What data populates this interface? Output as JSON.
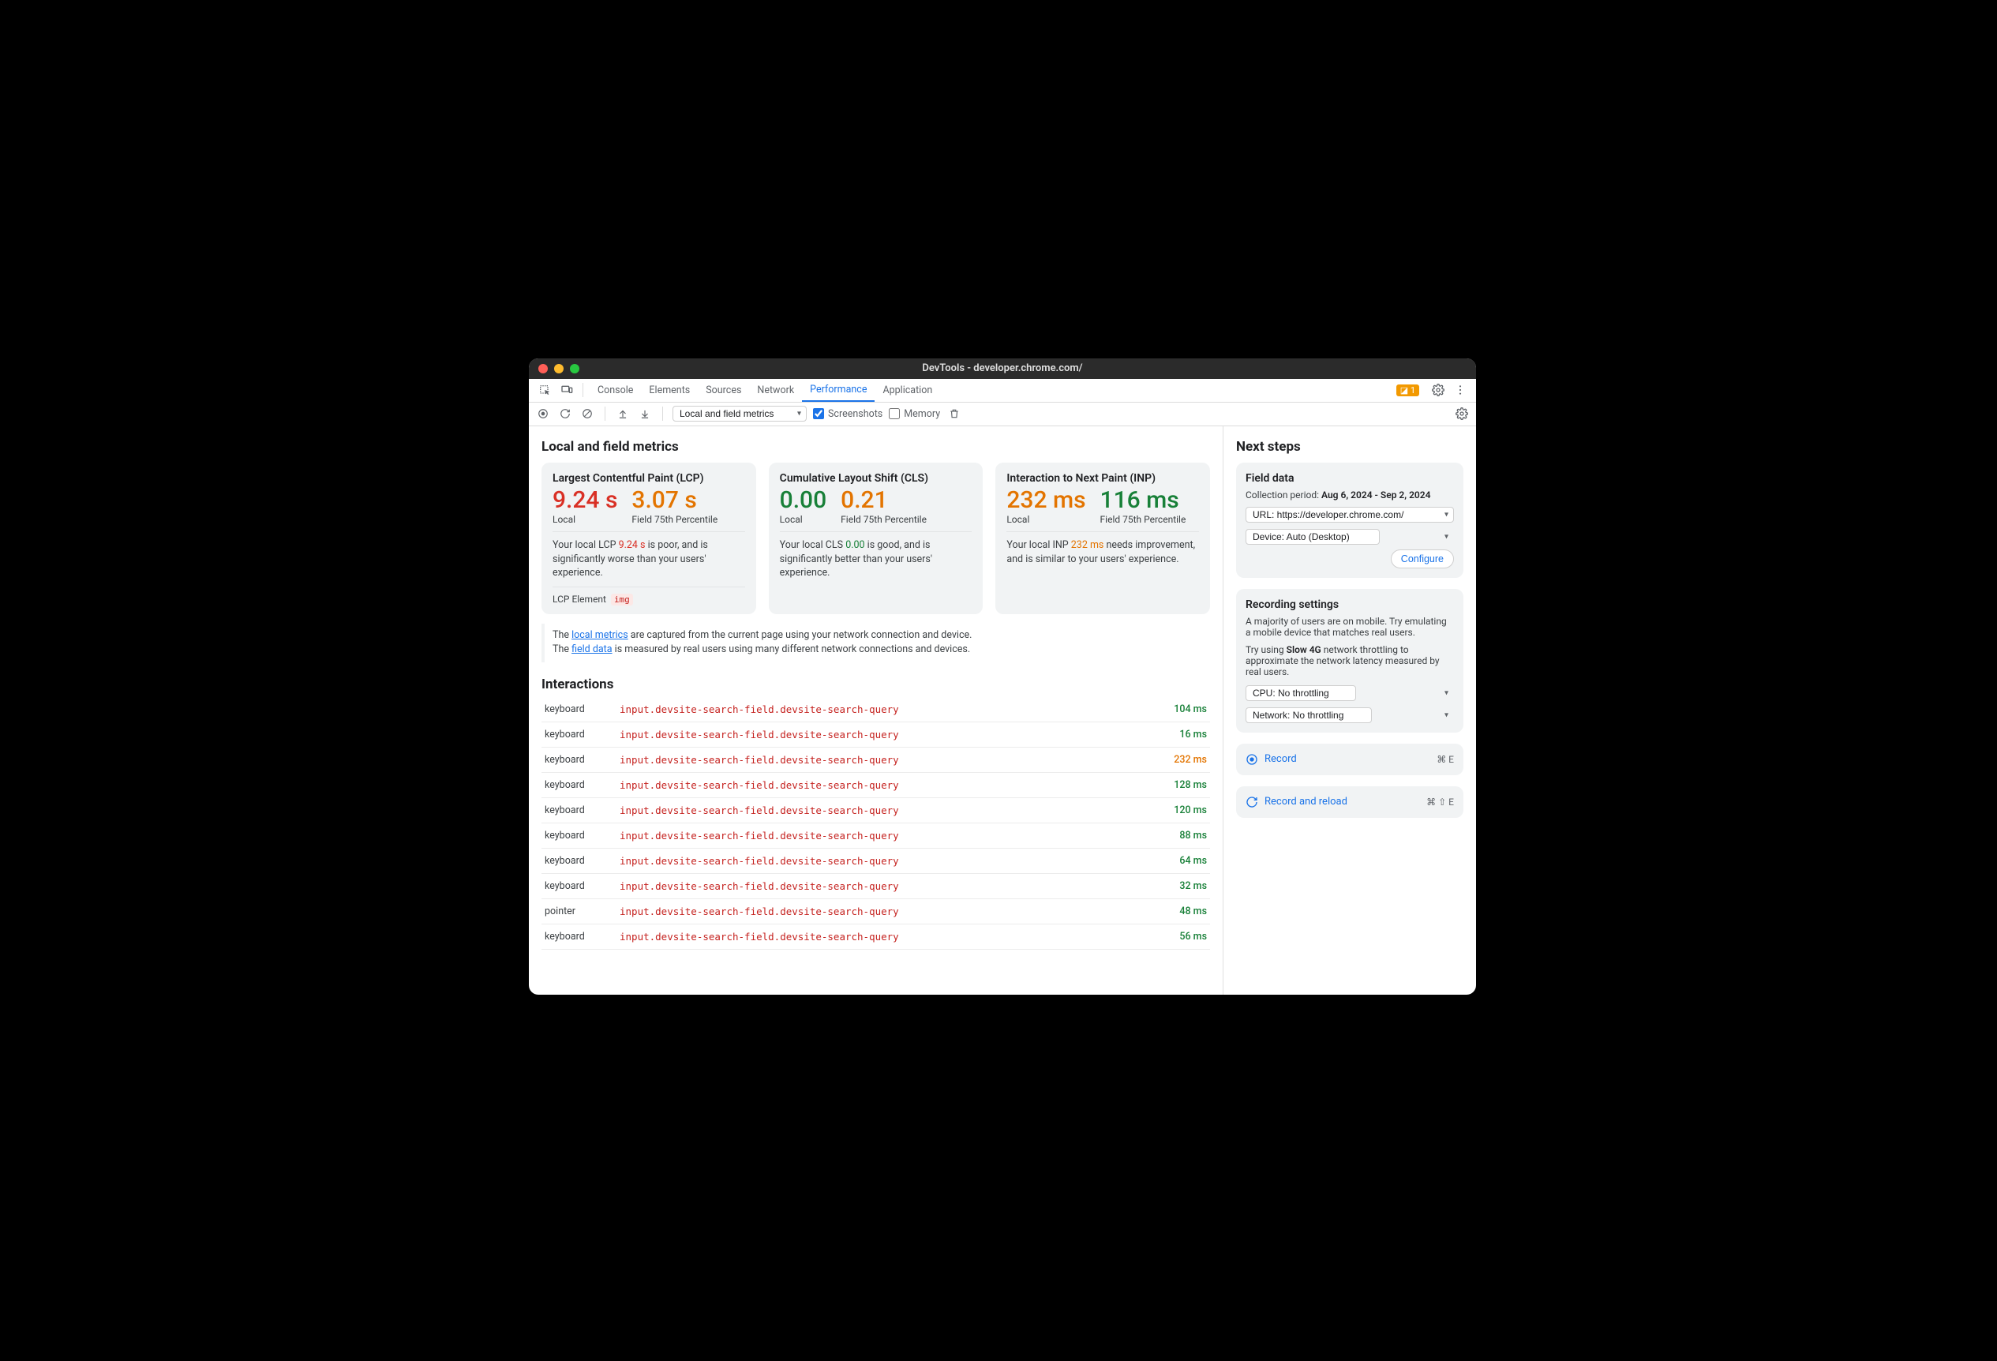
{
  "window": {
    "title": "DevTools - developer.chrome.com/"
  },
  "tabs": {
    "items": [
      "Console",
      "Elements",
      "Sources",
      "Network",
      "Performance",
      "Application"
    ],
    "active": "Performance",
    "warning_count": "1"
  },
  "toolbar": {
    "mode_select": "Local and field metrics",
    "screenshots_label": "Screenshots",
    "screenshots_checked": true,
    "memory_label": "Memory",
    "memory_checked": false
  },
  "main": {
    "heading": "Local and field metrics",
    "cards": {
      "lcp": {
        "title": "Largest Contentful Paint (LCP)",
        "local_value": "9.24 s",
        "local_label": "Local",
        "field_value": "3.07 s",
        "field_label": "Field 75th Percentile",
        "summary_pre": "Your local LCP ",
        "summary_val": "9.24 s",
        "summary_post": " is poor, and is significantly worse than your users' experience.",
        "extra_label": "LCP Element",
        "extra_chip": "img"
      },
      "cls": {
        "title": "Cumulative Layout Shift (CLS)",
        "local_value": "0.00",
        "local_label": "Local",
        "field_value": "0.21",
        "field_label": "Field 75th Percentile",
        "summary_pre": "Your local CLS ",
        "summary_val": "0.00",
        "summary_post": " is good, and is significantly better than your users' experience."
      },
      "inp": {
        "title": "Interaction to Next Paint (INP)",
        "local_value": "232 ms",
        "local_label": "Local",
        "field_value": "116 ms",
        "field_label": "Field 75th Percentile",
        "summary_pre": "Your local INP ",
        "summary_val": "232 ms",
        "summary_post": " needs improvement, and is similar to your users' experience."
      }
    },
    "infobox": {
      "line1_pre": "The ",
      "line1_link": "local metrics",
      "line1_post": " are captured from the current page using your network connection and device.",
      "line2_pre": "The ",
      "line2_link": "field data",
      "line2_post": " is measured by real users using many different network connections and devices."
    },
    "interactions_heading": "Interactions",
    "interactions": [
      {
        "type": "keyboard",
        "selector": "input.devsite-search-field.devsite-search-query",
        "time": "104 ms",
        "cls": "green"
      },
      {
        "type": "keyboard",
        "selector": "input.devsite-search-field.devsite-search-query",
        "time": "16 ms",
        "cls": "green"
      },
      {
        "type": "keyboard",
        "selector": "input.devsite-search-field.devsite-search-query",
        "time": "232 ms",
        "cls": "amber"
      },
      {
        "type": "keyboard",
        "selector": "input.devsite-search-field.devsite-search-query",
        "time": "128 ms",
        "cls": "green"
      },
      {
        "type": "keyboard",
        "selector": "input.devsite-search-field.devsite-search-query",
        "time": "120 ms",
        "cls": "green"
      },
      {
        "type": "keyboard",
        "selector": "input.devsite-search-field.devsite-search-query",
        "time": "88 ms",
        "cls": "green"
      },
      {
        "type": "keyboard",
        "selector": "input.devsite-search-field.devsite-search-query",
        "time": "64 ms",
        "cls": "green"
      },
      {
        "type": "keyboard",
        "selector": "input.devsite-search-field.devsite-search-query",
        "time": "32 ms",
        "cls": "green"
      },
      {
        "type": "pointer",
        "selector": "input.devsite-search-field.devsite-search-query",
        "time": "48 ms",
        "cls": "green"
      },
      {
        "type": "keyboard",
        "selector": "input.devsite-search-field.devsite-search-query",
        "time": "56 ms",
        "cls": "green"
      }
    ]
  },
  "side": {
    "heading": "Next steps",
    "field_data": {
      "title": "Field data",
      "period_label": "Collection period: ",
      "period_value": "Aug 6, 2024 - Sep 2, 2024",
      "url_select": "URL: https://developer.chrome.com/",
      "device_select": "Device: Auto (Desktop)",
      "configure": "Configure"
    },
    "rec_settings": {
      "title": "Recording settings",
      "para1": "A majority of users are on mobile. Try emulating a mobile device that matches real users.",
      "para2_pre": "Try using ",
      "para2_bold": "Slow 4G",
      "para2_post": " network throttling to approximate the network latency measured by real users.",
      "cpu_select": "CPU: No throttling",
      "net_select": "Network: No throttling"
    },
    "record": {
      "label": "Record",
      "shortcut": "⌘ E"
    },
    "record_reload": {
      "label": "Record and reload",
      "shortcut": "⌘ ⇧ E"
    }
  }
}
